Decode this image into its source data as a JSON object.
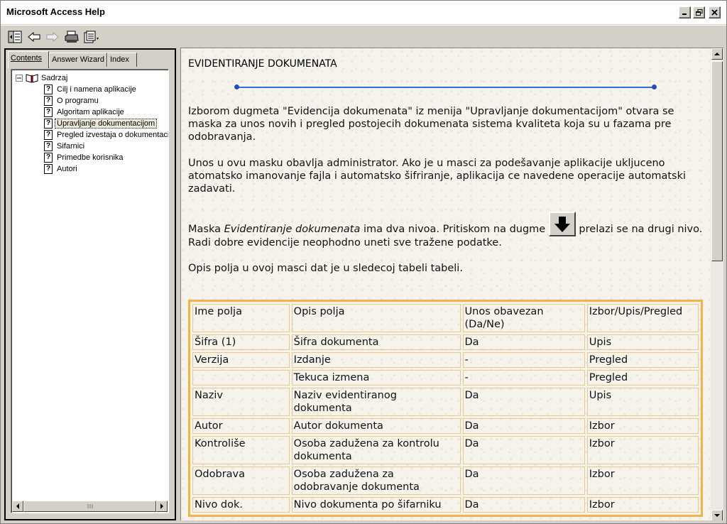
{
  "window": {
    "title": "Microsoft Access Help"
  },
  "toolbar": {
    "icons": [
      "hide-pane-icon",
      "back-arrow-icon",
      "forward-arrow-icon",
      "print-icon",
      "options-icon"
    ]
  },
  "left_pane": {
    "tabs": [
      {
        "label": "Contents",
        "active": true
      },
      {
        "label": "Answer Wizard",
        "active": false
      },
      {
        "label": "Index",
        "active": false
      }
    ],
    "tree": {
      "root": "Sadrzaj",
      "items": [
        "Cilj i namena aplikacije",
        "O programu",
        "Algoritam aplikacije",
        "Upravljanje dokumentacijom",
        "Pregled izvestaja o dokumentaciji",
        "Sifarnici",
        "Primedbe korisnika",
        "Autori"
      ],
      "selected_index": 3
    }
  },
  "content": {
    "heading": "EVIDENTIRANJE DOKUMENATA",
    "para1": "Izborom dugmeta \"Evidencija dokumenata\" iz menija \"Upravljanje dokumentacijom\" otvara se maska za unos novih i pregled postojecih dokumenata sistema kvaliteta koja su u fazama pre odobravanja.",
    "para2": "Unos u ovu masku obavlja administrator. Ako je u masci za podešavanje aplikacije ukljuceno atomatsko imanovanje fajla i automatsko šifriranje, aplikacija ce navedene operacije automatski zadavati.",
    "para3_a": "Maska ",
    "para3_italic": "Evidentiranje dokumenata",
    "para3_b": " ima dva nivoa. Pritiskom na dugme ",
    "para3_c": " prelazi se na drugi nivo. Radi dobre evidencije neophodno uneti sve tražene podatke.",
    "para4": "Opis polja u ovoj masci dat je u sledecoj tabeli tabeli.",
    "table": {
      "headers": [
        "Ime polja",
        "Opis polja",
        "Unos obavezan (Da/Ne)",
        "Izbor/Upis/Pregled"
      ],
      "rows": [
        [
          "Šifra (1)",
          "Šifra dokumenta",
          "Da",
          "Upis"
        ],
        [
          "Verzija",
          "Izdanje",
          "-",
          "Pregled"
        ],
        [
          "",
          "Tekuca izmena",
          "-",
          "Pregled"
        ],
        [
          "Naziv",
          "Naziv evidentiranog dokumenta",
          "Da",
          "Upis"
        ],
        [
          "Autor",
          "Autor dokumenta",
          "Da",
          "Izbor"
        ],
        [
          "Kontroliše",
          "Osoba zadužena za kontrolu dokumenta",
          "Da",
          "Izbor"
        ],
        [
          "Odobrava",
          "Osoba zadužena za odobravanje dokumenta",
          "Da",
          "Izbor"
        ],
        [
          "Nivo dok.",
          "Nivo dokumenta po šifarniku",
          "Da",
          "Izbor"
        ]
      ]
    }
  }
}
